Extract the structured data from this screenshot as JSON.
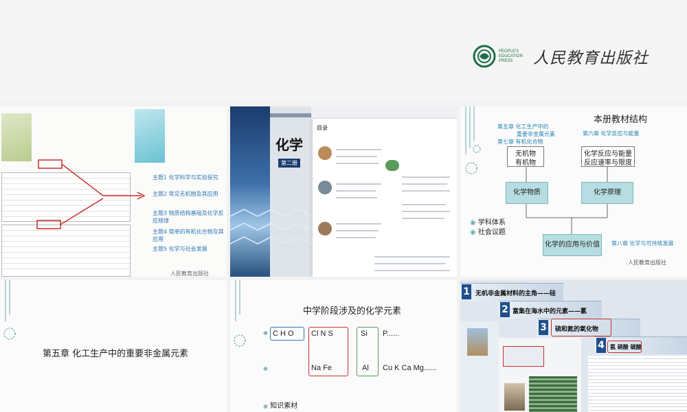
{
  "header": {
    "publisher_en": "PEOPLE'S EDUCATION PRESS",
    "publisher_cn": "人民教育出版社",
    "colors": {
      "brand": "#1f6e49"
    }
  },
  "slide1": {
    "themes": [
      "主题1  化学科学与实验探究",
      "主题2  常见无机物及其应用",
      "主题3  物质结构基础及化学反应规律",
      "主题4  简单的有机化合物及其应用",
      "主题5  化学与社会发展"
    ],
    "footer": "人民教育出版社"
  },
  "slide2": {
    "book_title": "化学",
    "book_volume": "第二册",
    "toc_title": "目录"
  },
  "slide3": {
    "title": "本册教材结构",
    "chapters_left": [
      "第五章  化工生产中的",
      "重要非金属元素",
      "第七章  有机化合物"
    ],
    "chapter_six": "第六章  化学反应与能量",
    "box_inorganic": [
      "无机物",
      "有机物"
    ],
    "box_reaction": [
      "化学反应与能量",
      "反应速率与限度"
    ],
    "box_substance": "化学物质",
    "box_principle": "化学原理",
    "box_application": "化学的应用与价值",
    "chapter_eight": "第八章  化学与可持续发展",
    "bullets": [
      "学科体系",
      "社会议题"
    ],
    "footer": "人民教育出版社"
  },
  "slide4": {
    "title": "第五章    化工生产中的重要非金属元素"
  },
  "slide5": {
    "title": "中学阶段涉及的化学元素",
    "row1": [
      "C  H  O",
      "Cl  N  S",
      "Si",
      "P......"
    ],
    "row2": [
      "Na  Fe",
      "Al",
      "Cu  K  Ca  Mg......"
    ],
    "bullet": "知识素材"
  },
  "slide6": {
    "bands": [
      {
        "num": "1",
        "label": "无机非金属材料的主角——硅"
      },
      {
        "num": "2",
        "label": "富集在海水中的元素——氯"
      },
      {
        "num": "3",
        "label": "硫和氮的氧化物"
      },
      {
        "num": "4",
        "label": "氨  硝酸  硫酸"
      }
    ]
  }
}
